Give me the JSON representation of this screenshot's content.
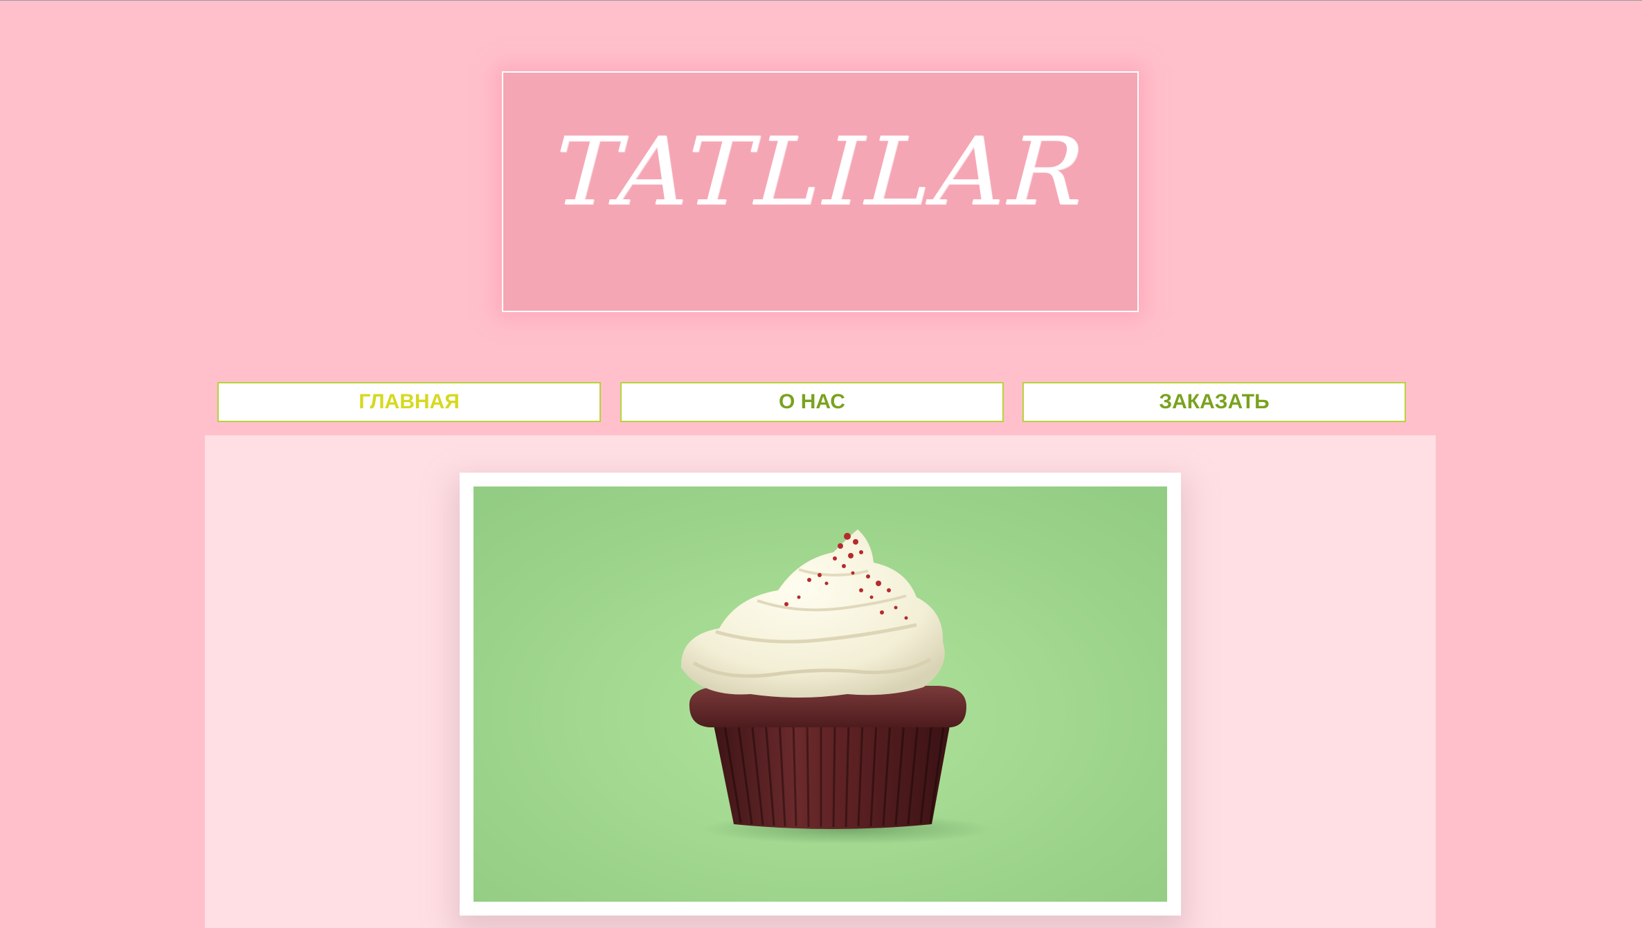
{
  "header": {
    "logo_text": "TATLILAR"
  },
  "nav": {
    "items": [
      {
        "label": "ГЛАВНАЯ",
        "active": true
      },
      {
        "label": "О НАС",
        "active": false
      },
      {
        "label": "ЗАКАЗАТЬ",
        "active": false
      }
    ]
  },
  "hero": {
    "image_subject": "cupcake-photo"
  },
  "colors": {
    "page_background": "#ffc0cb",
    "logo_box": "#f5a6b4",
    "content_background": "#ffdfe4",
    "nav_border": "#b8d23a",
    "nav_text": "#7aa21f",
    "nav_active_text": "#d6d91f",
    "photo_background": "#a8df98"
  }
}
